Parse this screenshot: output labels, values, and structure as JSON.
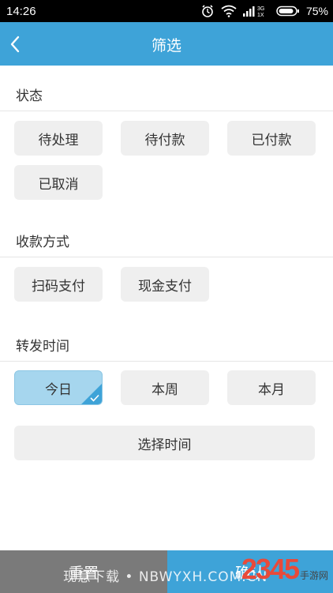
{
  "status_bar": {
    "time": "14:26",
    "network": "3G",
    "network2": "1X",
    "battery": "75%",
    "icons": [
      "alarm-icon",
      "wifi-icon",
      "signal-icon",
      "battery-icon"
    ]
  },
  "header": {
    "title": "筛选",
    "back_icon": "chevron-left-icon"
  },
  "sections": {
    "status": {
      "title": "状态",
      "options": [
        "待处理",
        "待付款",
        "已付款",
        "已取消"
      ]
    },
    "payment": {
      "title": "收款方式",
      "options": [
        "扫码支付",
        "现金支付"
      ]
    },
    "time": {
      "title": "转发时间",
      "options": [
        "今日",
        "本周",
        "本月"
      ],
      "selected": "今日",
      "custom_label": "选择时间"
    }
  },
  "footer": {
    "reset_label": "重置",
    "confirm_label": "确认",
    "watermark": "现意下载 • NBWYXH.COM.CN",
    "logo_text": "2345",
    "logo_sub": "手游网"
  },
  "colors": {
    "primary": "#3ea3d8",
    "selected_chip": "#a6d6ee",
    "chip": "#efefef",
    "reset": "#7a7a7a"
  }
}
